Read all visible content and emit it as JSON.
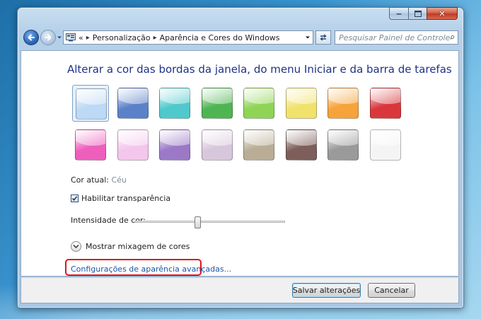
{
  "address": {
    "prefix": "«",
    "crumbs": [
      "Personalização",
      "Aparência e Cores do Windows"
    ],
    "separator": "▸"
  },
  "search": {
    "placeholder": "Pesquisar Painel de Controle"
  },
  "main": {
    "title": "Alterar a cor das bordas da janela, do menu Iniciar e da barra de tarefas",
    "current_color_label": "Cor atual:",
    "current_color_value": "Céu",
    "transparency_label": "Habilitar transparência",
    "transparency_checked": true,
    "intensity_label": "Intensidade de cor:",
    "intensity_level": 0.42,
    "mixer_label": "Mostrar mixagem de cores",
    "advanced_link": "Configurações de aparência avançadas..."
  },
  "swatches": [
    {
      "color": "#bcd9f5",
      "selected": true
    },
    {
      "color": "#5b82c9",
      "selected": false
    },
    {
      "color": "#4fc9cc",
      "selected": false
    },
    {
      "color": "#4fb552",
      "selected": false
    },
    {
      "color": "#8fd455",
      "selected": false
    },
    {
      "color": "#f1e26b",
      "selected": false
    },
    {
      "color": "#f5a33a",
      "selected": false
    },
    {
      "color": "#d9373c",
      "selected": false
    },
    {
      "color": "#ee5fbc",
      "selected": false
    },
    {
      "color": "#f3c6ec",
      "selected": false
    },
    {
      "color": "#9b79c7",
      "selected": false
    },
    {
      "color": "#d8c7dc",
      "selected": false
    },
    {
      "color": "#b9ad95",
      "selected": false
    },
    {
      "color": "#7d5e5a",
      "selected": false
    },
    {
      "color": "#9a9a9a",
      "selected": false
    },
    {
      "color": "#f4f4f4",
      "selected": false
    }
  ],
  "footer": {
    "save_label": "Salvar alterações",
    "cancel_label": "Cancelar"
  },
  "colors": {
    "title_text": "#1e3287",
    "link": "#1a55a8",
    "highlight": "#e0141b"
  }
}
